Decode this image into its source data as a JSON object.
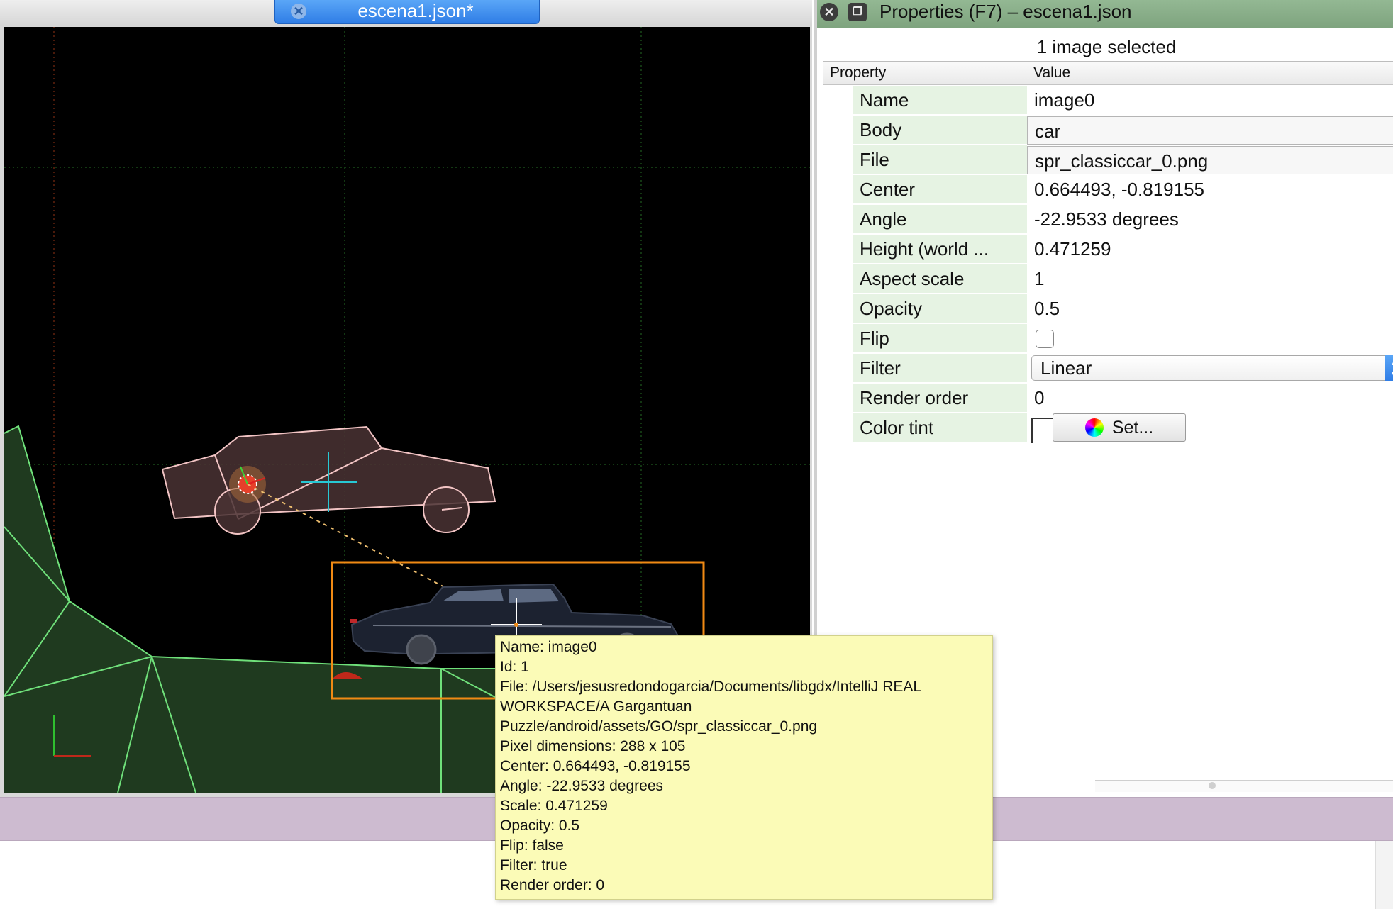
{
  "editor": {
    "tab_title": "escena1.json*",
    "close_glyph": "✕"
  },
  "properties": {
    "title": "Properties (F7) – escena1.json",
    "selection_summary": "1 image selected",
    "columns": {
      "property": "Property",
      "value": "Value"
    },
    "rows": [
      {
        "key": "Name",
        "value": "image0",
        "kind": "text"
      },
      {
        "key": "Body",
        "value": "car",
        "kind": "field"
      },
      {
        "key": "File",
        "value": "spr_classiccar_0.png",
        "kind": "field"
      },
      {
        "key": "Center",
        "value": "0.664493, -0.819155",
        "kind": "text"
      },
      {
        "key": "Angle",
        "value": "-22.9533 degrees",
        "kind": "text"
      },
      {
        "key": "Height (world ...",
        "value": "0.471259",
        "kind": "text"
      },
      {
        "key": "Aspect scale",
        "value": "1",
        "kind": "text"
      },
      {
        "key": "Opacity",
        "value": "0.5",
        "kind": "text"
      },
      {
        "key": "Flip",
        "value": "",
        "kind": "checkbox",
        "checked": false
      },
      {
        "key": "Filter",
        "value": "Linear",
        "kind": "select"
      },
      {
        "key": "Render order",
        "value": "0",
        "kind": "text"
      },
      {
        "key": "Color tint",
        "value": "",
        "kind": "color",
        "button_label": "Set..."
      }
    ]
  },
  "tooltip": {
    "lines": [
      "Name: image0",
      "Id: 1",
      "File: /Users/jesusredondogarcia/Documents/libgdx/IntelliJ REAL",
      "WORKSPACE/A Gargantuan",
      "Puzzle/android/assets/GO/spr_classiccar_0.png",
      "Pixel dimensions: 288 x 105",
      "Center: 0.664493, -0.819155",
      "Angle: -22.9533 degrees",
      "Scale: 0.471259",
      "Opacity: 0.5",
      "Flip: false",
      "Filter: true",
      "Render order: 0"
    ]
  },
  "colors": {
    "canvas_bg": "#000000",
    "ground_fill": "#1f3a1f",
    "ground_line": "#6fe07a",
    "body_outline": "#f2c4c4",
    "selection": "#f08a14",
    "tooltip_bg": "#fbfbb7",
    "props_title_bg": "#86aa86",
    "prop_key_bg": "#e6f3e3"
  }
}
